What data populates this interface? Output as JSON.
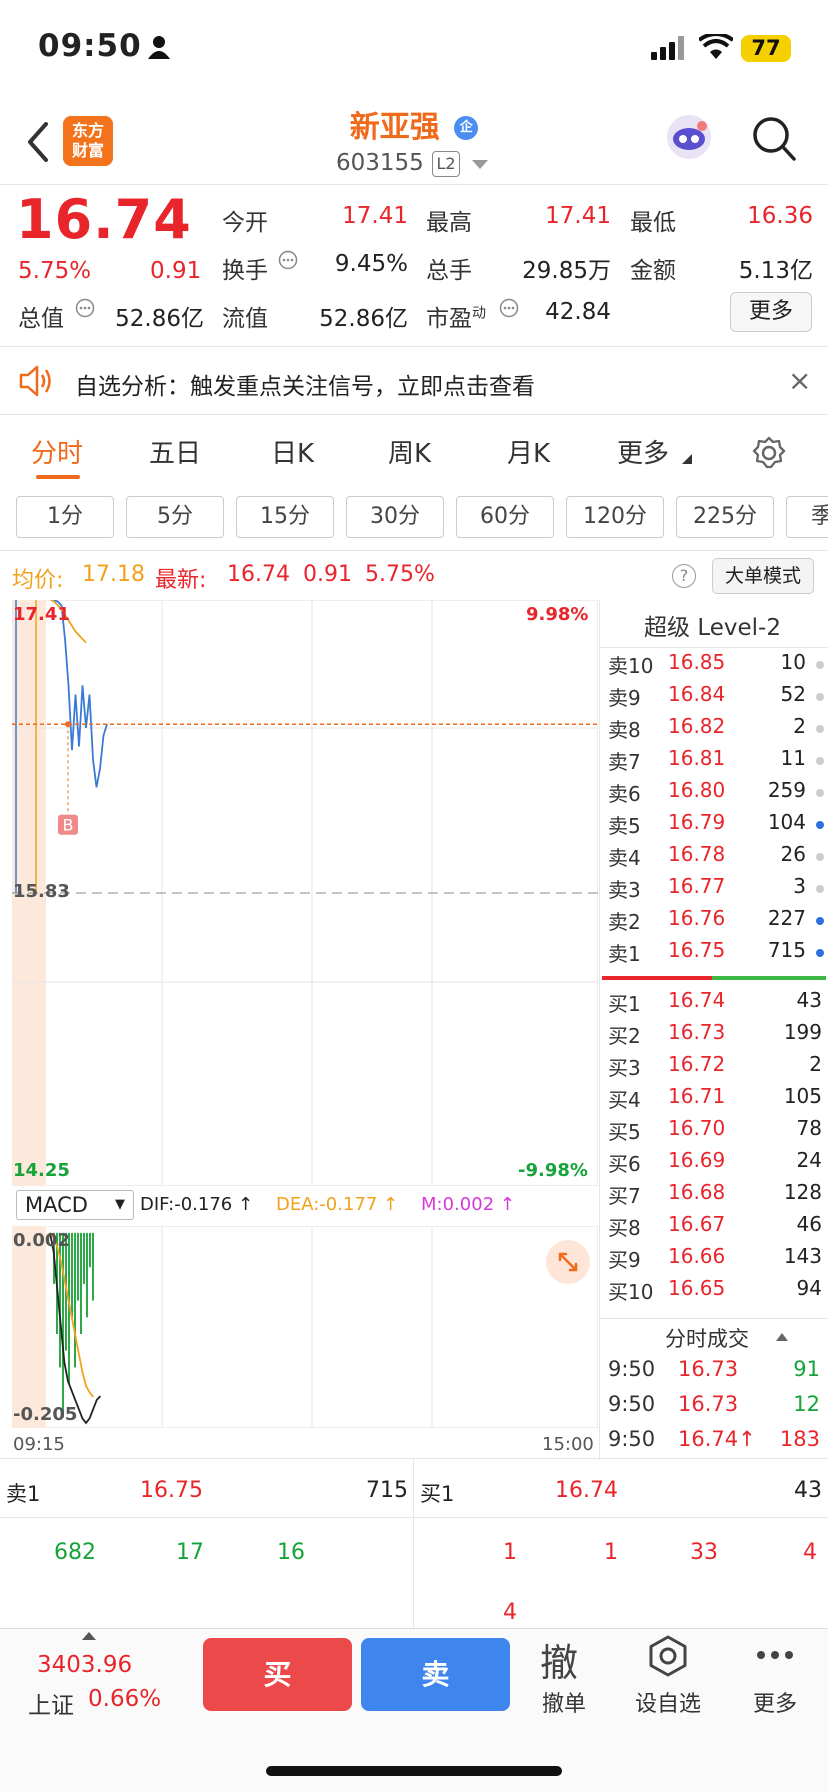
{
  "status_bar": {
    "time": "09:50",
    "battery": "77"
  },
  "header": {
    "logo_line1": "东方",
    "logo_line2": "财富",
    "stock_name": "新亚强",
    "badge": "企",
    "stock_code": "603155",
    "level_badge": "L2"
  },
  "quote": {
    "price": "16.74",
    "change_pct": "5.75%",
    "change": "0.91",
    "open_label": "今开",
    "open": "17.41",
    "high_label": "最高",
    "high": "17.41",
    "low_label": "最低",
    "low": "16.36",
    "turnover_label": "换手",
    "turnover": "9.45%",
    "volume_label": "总手",
    "volume": "29.85万",
    "amount_label": "金额",
    "amount": "5.13亿",
    "mktcap_label": "总值",
    "mktcap": "52.86亿",
    "float_label": "流值",
    "float": "52.86亿",
    "pe_label": "市盈",
    "pe_sup": "动",
    "pe": "42.84",
    "more": "更多"
  },
  "notice": {
    "text": "自选分析：触发重点关注信号，立即点击查看",
    "close": "×"
  },
  "tabs": [
    "分时",
    "五日",
    "日K",
    "周K",
    "月K",
    "更多"
  ],
  "minute_intervals": [
    "1分",
    "5分",
    "15分",
    "30分",
    "60分",
    "120分",
    "225分",
    "季"
  ],
  "chart_info": {
    "avg_label": "均价:",
    "avg": "17.18",
    "latest_label": "最新:",
    "latest": "16.74",
    "latest_change": "0.91",
    "latest_pct": "5.75%",
    "help": "?",
    "big_order_mode": "大单模式"
  },
  "chart_data": [
    {
      "type": "line",
      "title": "",
      "xlabel": "",
      "ylabel": "",
      "x_ticks": [
        "09:15",
        "15:00"
      ],
      "y_ticks_left": [
        "17.41",
        "15.83",
        "14.25"
      ],
      "y_ticks_right": [
        "9.98%",
        "-9.98%"
      ],
      "ylim": [
        14.25,
        17.41
      ],
      "prev_close": 15.83,
      "series": [
        {
          "name": "最新",
          "color": "#3a7bd5",
          "values": [
            17.41,
            17.41,
            17.4,
            17.38,
            17.2,
            16.95,
            16.6,
            16.9,
            16.62,
            16.95,
            16.72,
            16.9,
            16.55,
            16.4,
            16.5,
            16.68,
            16.74
          ]
        },
        {
          "name": "均价",
          "color": "#f0a21f",
          "values": [
            17.41,
            17.4,
            17.38,
            17.36,
            17.33,
            17.3,
            17.27,
            17.24,
            17.22,
            17.2,
            17.18
          ]
        }
      ],
      "reference_line": 16.74,
      "marker": "B",
      "marker_value": 16.36
    },
    {
      "type": "bar",
      "title": "MACD",
      "indicator": "MACD",
      "dif_label": "DIF:",
      "dif": "-0.176",
      "dea_label": "DEA:",
      "dea": "-0.177",
      "m_label": "M:",
      "m": "0.002",
      "y_ticks": [
        "0.002",
        "-0.205"
      ],
      "ylim": [
        -0.205,
        0.002
      ],
      "histogram": [
        0,
        -0.03,
        -0.06,
        -0.08,
        -0.11,
        -0.07,
        -0.09,
        -0.05,
        -0.08,
        -0.04,
        -0.06,
        -0.03,
        -0.05,
        -0.02,
        -0.04
      ],
      "dif_values": [
        0,
        -0.02,
        -0.06,
        -0.1,
        -0.14,
        -0.16,
        -0.17,
        -0.18,
        -0.19,
        -0.2,
        -0.205,
        -0.2,
        -0.19,
        -0.18,
        -0.176
      ],
      "dea_values": [
        0,
        -0.005,
        -0.015,
        -0.03,
        -0.05,
        -0.07,
        -0.09,
        -0.11,
        -0.13,
        -0.15,
        -0.165,
        -0.172,
        -0.177
      ]
    }
  ],
  "order_book": {
    "title": "超级 Level-2",
    "asks": [
      {
        "label": "卖10",
        "price": "16.85",
        "vol": "10",
        "dot": "gray"
      },
      {
        "label": "卖9",
        "price": "16.84",
        "vol": "52",
        "dot": "gray"
      },
      {
        "label": "卖8",
        "price": "16.82",
        "vol": "2",
        "dot": "gray"
      },
      {
        "label": "卖7",
        "price": "16.81",
        "vol": "11",
        "dot": "gray"
      },
      {
        "label": "卖6",
        "price": "16.80",
        "vol": "259",
        "dot": "gray"
      },
      {
        "label": "卖5",
        "price": "16.79",
        "vol": "104",
        "dot": "blue"
      },
      {
        "label": "卖4",
        "price": "16.78",
        "vol": "26",
        "dot": "gray"
      },
      {
        "label": "卖3",
        "price": "16.77",
        "vol": "3",
        "dot": "gray"
      },
      {
        "label": "卖2",
        "price": "16.76",
        "vol": "227",
        "dot": "blue"
      },
      {
        "label": "卖1",
        "price": "16.75",
        "vol": "715",
        "dot": "blue"
      }
    ],
    "bids": [
      {
        "label": "买1",
        "price": "16.74",
        "vol": "43"
      },
      {
        "label": "买2",
        "price": "16.73",
        "vol": "199"
      },
      {
        "label": "买3",
        "price": "16.72",
        "vol": "2"
      },
      {
        "label": "买4",
        "price": "16.71",
        "vol": "105"
      },
      {
        "label": "买5",
        "price": "16.70",
        "vol": "78"
      },
      {
        "label": "买6",
        "price": "16.69",
        "vol": "24"
      },
      {
        "label": "买7",
        "price": "16.68",
        "vol": "128"
      },
      {
        "label": "买8",
        "price": "16.67",
        "vol": "46"
      },
      {
        "label": "买9",
        "price": "16.66",
        "vol": "143"
      },
      {
        "label": "买10",
        "price": "16.65",
        "vol": "94"
      }
    ],
    "trades_title": "分时成交",
    "trades": [
      {
        "time": "9:50",
        "price": "16.73",
        "vol": "91",
        "dir": "green"
      },
      {
        "time": "9:50",
        "price": "16.73",
        "vol": "12",
        "dir": "green"
      },
      {
        "time": "9:50",
        "price": "16.74↑",
        "vol": "183",
        "dir": "red"
      }
    ]
  },
  "summary": {
    "ask_label": "卖1",
    "ask_price": "16.75",
    "ask_vol": "715",
    "bid_label": "买1",
    "bid_price": "16.74",
    "bid_vol": "43",
    "ask_queue": [
      "682",
      "17",
      "16"
    ],
    "bid_queue": [
      "1",
      "1",
      "33",
      "4",
      "4"
    ]
  },
  "bottom_bar": {
    "index_value": "3403.96",
    "index_name": "上证",
    "index_pct": "0.66%",
    "buy": "买",
    "sell": "卖",
    "cancel_icon_char": "撤",
    "cancel": "撤单",
    "watchlist": "设自选",
    "more": "更多"
  }
}
